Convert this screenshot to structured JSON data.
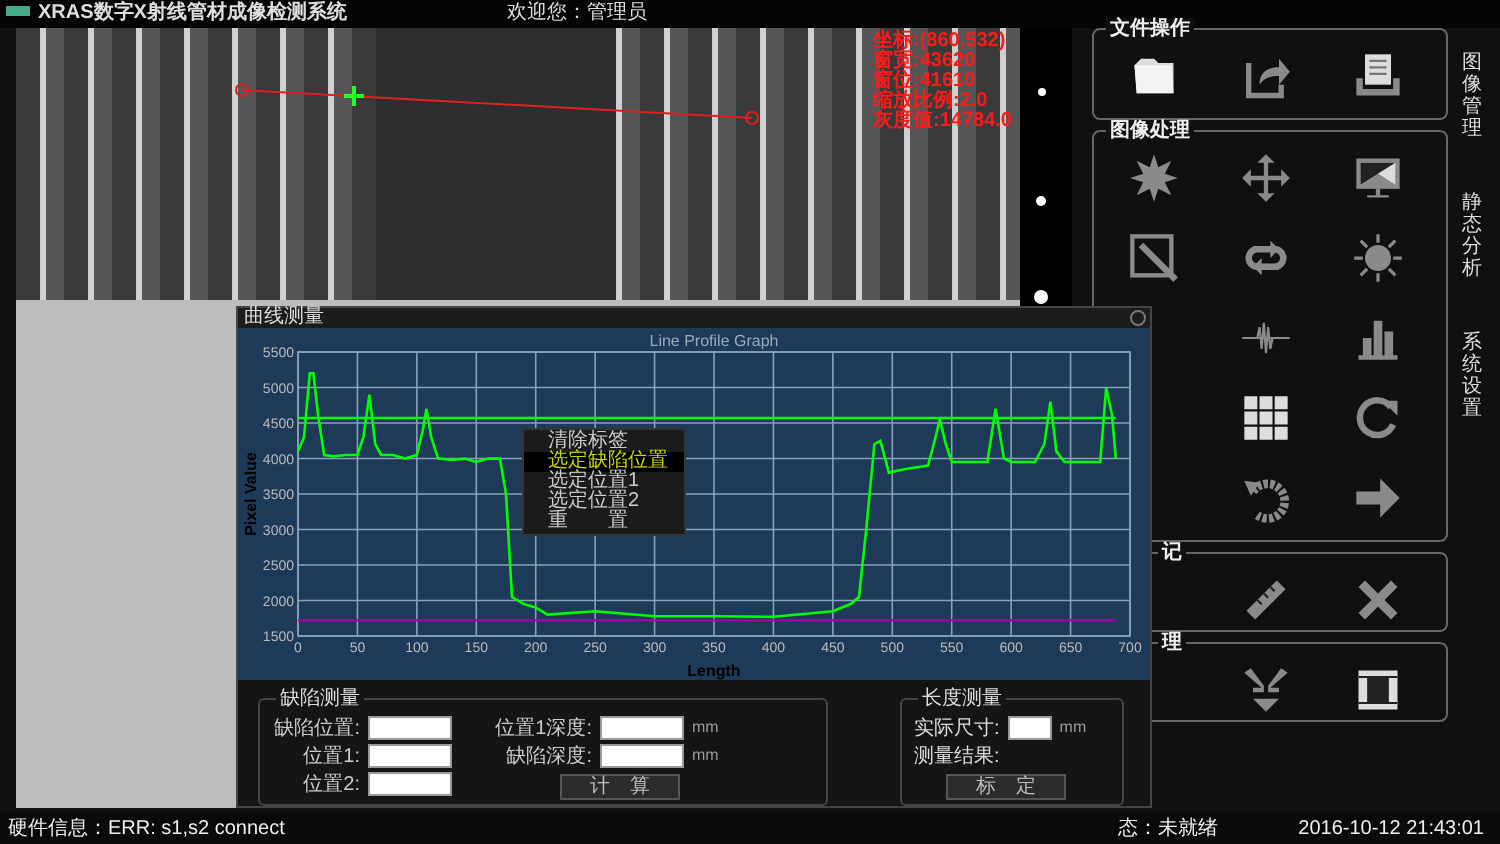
{
  "window": {
    "title": "XRAS数字X射线管材成像检测系统",
    "welcome": "欢迎您：管理员"
  },
  "image_view": {
    "readings": [
      "坐标:(860,532)",
      "窗宽:43620",
      "窗位:41610",
      "缩放比例:2.0",
      "灰度值:14784.0"
    ]
  },
  "panels": [
    {
      "title": "文件操作"
    },
    {
      "title": "图像处理"
    },
    {
      "title": "记"
    },
    {
      "title": "理"
    }
  ],
  "side_tabs": [
    {
      "label": "图像管理"
    },
    {
      "label": "静态分析"
    },
    {
      "label": "系统设置"
    }
  ],
  "dialog": {
    "title": "曲线测量",
    "chart_data": {
      "type": "line",
      "title": "Line Profile Graph",
      "xlabel": "Length",
      "ylabel": "Pixel Value",
      "x": [
        0,
        5,
        10,
        13,
        17,
        22,
        30,
        40,
        50,
        55,
        60,
        65,
        70,
        80,
        90,
        100,
        105,
        108,
        112,
        118,
        130,
        140,
        150,
        160,
        170,
        175,
        180,
        190,
        200,
        210,
        250,
        300,
        350,
        400,
        450,
        465,
        472,
        478,
        485,
        490,
        497,
        510,
        530,
        535,
        540,
        545,
        550,
        570,
        580,
        587,
        594,
        600,
        620,
        628,
        633,
        638,
        645,
        660,
        675,
        680,
        685,
        688
      ],
      "series": [
        {
          "color": "#00ff00",
          "values": [
            4100,
            4300,
            5200,
            5200,
            4600,
            4050,
            4030,
            4050,
            4050,
            4300,
            4900,
            4200,
            4050,
            4050,
            4000,
            4050,
            4400,
            4700,
            4300,
            4000,
            3980,
            4000,
            3950,
            4000,
            4000,
            3500,
            2050,
            1950,
            1900,
            1800,
            1850,
            1780,
            1780,
            1770,
            1850,
            1950,
            2050,
            3000,
            4200,
            4250,
            3800,
            3850,
            3900,
            4200,
            4550,
            4200,
            3950,
            3950,
            3950,
            4700,
            4000,
            3950,
            3950,
            4200,
            4800,
            4100,
            3950,
            3950,
            3950,
            5000,
            4600,
            4000
          ]
        }
      ],
      "xlim": [
        0,
        700
      ],
      "ylim": [
        1500,
        5500
      ],
      "xticks": [
        0,
        50,
        100,
        150,
        200,
        250,
        300,
        350,
        400,
        450,
        500,
        550,
        600,
        650,
        700
      ],
      "yticks": [
        1500,
        2000,
        2500,
        3000,
        3500,
        4000,
        4500,
        5000,
        5500
      ],
      "grid": true,
      "ref_lines": [
        {
          "axis": "y",
          "value": 4570,
          "color": "#00ff00"
        },
        {
          "axis": "y",
          "value": 1720,
          "color": "#aa00aa"
        }
      ]
    },
    "context_menu": [
      {
        "label": "清除标签",
        "selected": false
      },
      {
        "label": "选定缺陷位置",
        "selected": true
      },
      {
        "label": "选定位置1",
        "selected": false
      },
      {
        "label": "选定位置2",
        "selected": false
      },
      {
        "label": "重　　置",
        "selected": false
      }
    ],
    "defect_group": {
      "title": "缺陷测量",
      "left_fields": [
        {
          "label": "缺陷位置:"
        },
        {
          "label": "位置1:"
        },
        {
          "label": "位置2:"
        }
      ],
      "right_fields": [
        {
          "label": "位置1深度:",
          "unit": "mm"
        },
        {
          "label": "缺陷深度:",
          "unit": "mm"
        }
      ],
      "button": "计　算"
    },
    "length_group": {
      "title": "长度测量",
      "size_label": "实际尺寸:",
      "size_unit": "mm",
      "result_label": "测量结果:",
      "button": "标　定"
    }
  },
  "status_bar": {
    "hardware": "硬件信息：ERR: s1,s2 connect",
    "state": "态：未就绪",
    "datetime": "2016-10-12 21:43:01"
  }
}
